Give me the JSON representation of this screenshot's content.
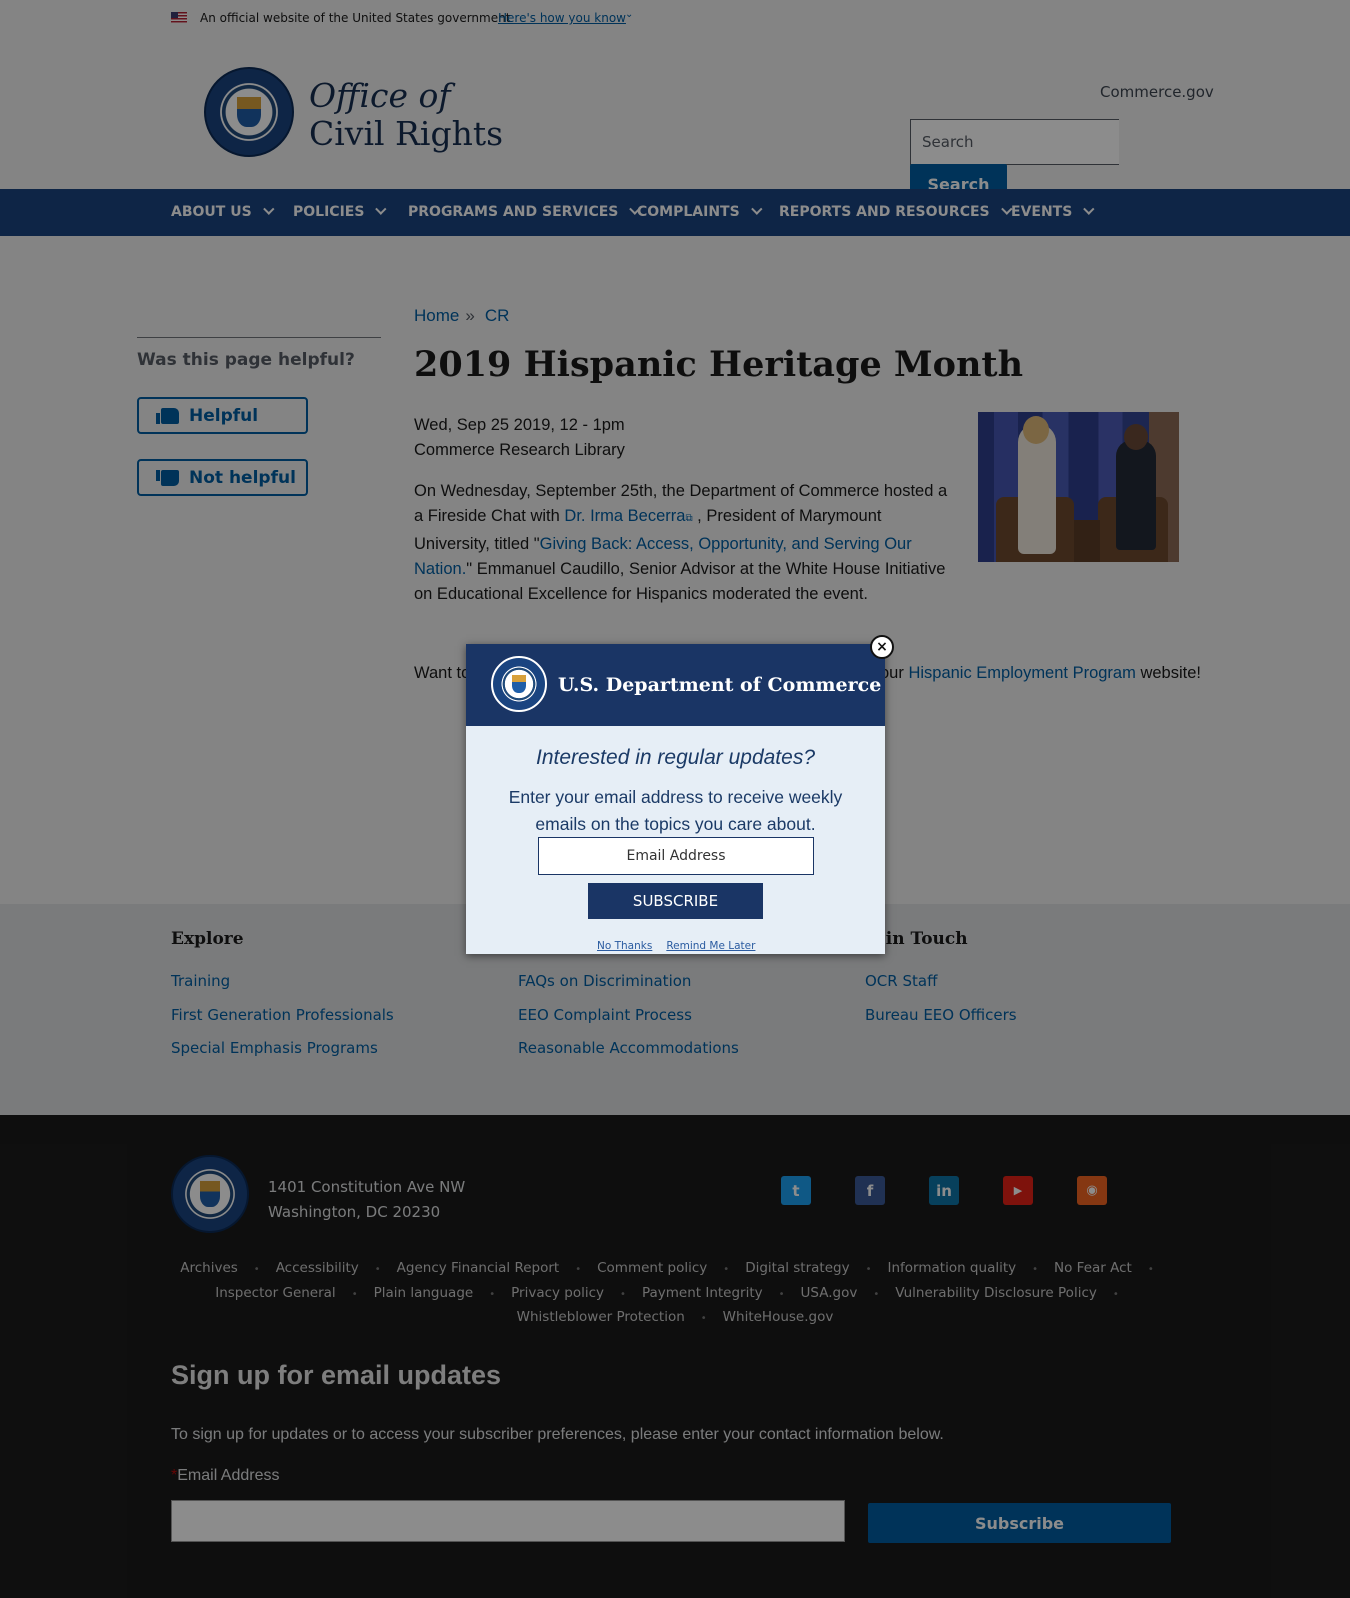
{
  "gov_banner": {
    "official_text": "An official website of the United States government",
    "how_know": "Here's how you know"
  },
  "header": {
    "title_line1": "Office of",
    "title_line2": "Civil Rights",
    "commerce_link": "Commerce.gov",
    "search_placeholder": "Search",
    "search_button": "Search"
  },
  "nav": {
    "items": [
      "ABOUT US",
      "POLICIES",
      "PROGRAMS AND SERVICES",
      "COMPLAINTS",
      "REPORTS AND RESOURCES",
      "EVENTS"
    ]
  },
  "sidebar": {
    "question": "Was this page helpful?",
    "helpful": "Helpful",
    "not_helpful": "Not helpful"
  },
  "breadcrumb": {
    "home": "Home",
    "separator": "»",
    "current": "CR"
  },
  "article": {
    "title": "2019 Hispanic Heritage Month",
    "date": "Wed, Sep 25 2019, 12 - 1pm",
    "location": "Commerce Research Library",
    "body_part1": "On Wednesday, September 25th, the Department of Commerce hosted a a Fireside Chat with ",
    "body_link1": "Dr. Irma Becerra",
    "body_part2": " , President of Marymount University, titled \"",
    "body_link2": "Giving Back: Access, Opportunity, and Serving Our Nation.",
    "body_part3": "\" Emmanuel Caudillo, Senior Advisor at the White House Initiative on Educational Excellence for Hispanics moderated the event.",
    "want_start": "Want to",
    "want_mid": "our ",
    "want_link": "Hispanic Employment Program",
    "want_end": " website!"
  },
  "explore": {
    "col1_heading": "Explore",
    "col1_links": [
      "Training",
      "First Generation Professionals",
      "Special Emphasis Programs"
    ],
    "col2_links": [
      "FAQs on Discrimination",
      "EEO Complaint Process",
      "Reasonable Accommodations"
    ],
    "col3_heading": "t in Touch",
    "col3_links": [
      "OCR Staff",
      "Bureau EEO Officers"
    ]
  },
  "footer": {
    "address_line1": "1401 Constitution Ave NW",
    "address_line2": "Washington, DC 20230",
    "social_icons": [
      "twitter-icon",
      "facebook-icon",
      "linkedin-icon",
      "youtube-icon",
      "rss-icon"
    ],
    "links_row1": [
      "Archives",
      "Accessibility",
      "Agency Financial Report",
      "Comment policy",
      "Digital strategy",
      "Information quality",
      "No Fear Act"
    ],
    "links_row2": [
      "Inspector General",
      "Plain language",
      "Privacy policy",
      "Payment Integrity",
      "USA.gov",
      "Vulnerability Disclosure Policy"
    ],
    "links_row3": [
      "Whistleblower Protection",
      "WhiteHouse.gov"
    ],
    "signup_title": "Sign up for email updates",
    "signup_desc": "To sign up for updates or to access your subscriber preferences, please enter your contact information below.",
    "signup_required_mark": "*",
    "signup_label": "Email Address",
    "signup_button": "Subscribe"
  },
  "modal": {
    "org_name": "U.S. Department of Commerce",
    "question": "Interested in regular updates?",
    "description": "Enter your email address to receive weekly emails on the topics you care about.",
    "email_placeholder": "Email Address",
    "subscribe_button": "SUBSCRIBE",
    "no_thanks": "No Thanks",
    "remind_later": "Remind Me Later",
    "close_glyph": "×"
  },
  "colors": {
    "nav_bg": "#1a4480",
    "link": "#005ea2",
    "modal_header": "#1a3565",
    "twitter": "#1da1f2",
    "facebook": "#3b5998",
    "linkedin": "#0e76a8",
    "youtube": "#e62117",
    "rss": "#f26522"
  }
}
